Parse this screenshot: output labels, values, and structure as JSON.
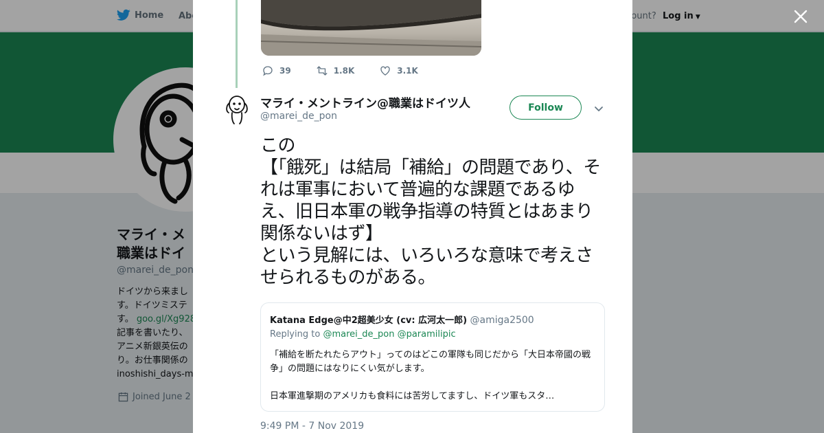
{
  "nav": {
    "home_label": "Home",
    "about_label": "Abo",
    "account_prompt": "ccount?",
    "login_label": "Log in"
  },
  "profile": {
    "name_line1": "マライ・メ",
    "name_line2": "職業はドイ",
    "handle": "@marei_de_pon",
    "bio_lines": [
      "ドイツから来まし",
      "す。ドイツミステ",
      "記事を書いたり、",
      "アニメ新銀英伝の",
      "り。お仕事関係の"
    ],
    "bio_line3_text": "す。",
    "bio_link": "goo.gl/Xg928",
    "bio_last": "inoshishi_days-ma",
    "joined": "Joined June 2"
  },
  "modal": {
    "prev_actions": {
      "replies": "39",
      "retweets": "1.8K",
      "likes": "3.1K"
    },
    "tweet": {
      "author_name": "マライ・メントライン@職業はドイツ人",
      "author_handle": "@marei_de_pon",
      "follow_label": "Follow",
      "text": "この\n【「餓死」は結局「補給」の問題であり、それは軍事において普遍的な課題であるゆえ、旧日本軍の戦争指導の特質とはあまり関係ないはず】\nという見解には、いろいろな意味で考えさせられるものがある。",
      "timestamp": "9:49 PM - 7 Nov 2019"
    },
    "quote": {
      "name": "Katana Edge@中2超美少女 (cv: 広河太一郎)",
      "handle": "@amiga2500",
      "reply_prefix": "Replying to",
      "reply_mention1": "@marei_de_pon",
      "reply_mention2": "@paramilipic",
      "text": "「補給を断たれたらアウト」ってのはどこの軍隊も同じだから「大日本帝國の戦争」の問題にはなりにくい気がします。\n\n日本軍進撃期のアメリカも食料には苦労してますし、ドイツ軍もスタ…"
    }
  },
  "colors": {
    "accent": "#1b8754",
    "banner": "#1b8754",
    "thread_line": "#a8d1b9",
    "muted": "#657786"
  }
}
